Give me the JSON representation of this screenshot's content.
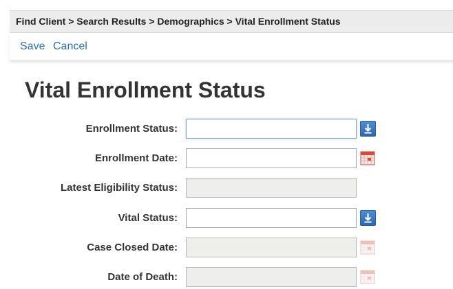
{
  "breadcrumb": {
    "text": "Find Client > Search Results > Demographics > Vital Enrollment Status"
  },
  "actions": {
    "save_label": "Save",
    "cancel_label": "Cancel"
  },
  "page": {
    "title": "Vital Enrollment Status"
  },
  "form": {
    "fields": [
      {
        "label": "Enrollment Status:",
        "value": "",
        "control": "dropdown",
        "editable": true
      },
      {
        "label": "Enrollment Date:",
        "value": "",
        "control": "date-picker",
        "editable": true
      },
      {
        "label": "Latest Eligibility Status:",
        "value": "",
        "control": "text",
        "editable": false
      },
      {
        "label": "Vital Status:",
        "value": "",
        "control": "dropdown",
        "editable": true
      },
      {
        "label": "Case Closed Date:",
        "value": "",
        "control": "date-picker",
        "editable": false
      },
      {
        "label": "Date of Death:",
        "value": "",
        "control": "date-picker",
        "editable": false
      }
    ]
  },
  "icons": {
    "dropdown": "download-arrow-icon",
    "date_picker": "calendar-icon"
  },
  "colors": {
    "link": "#2a6fc0",
    "dropdown_button": "#2f73c4",
    "calendar": "#d84a3a",
    "readonly_field": "#eeeeec",
    "breadcrumb_bar": "#ececec"
  }
}
